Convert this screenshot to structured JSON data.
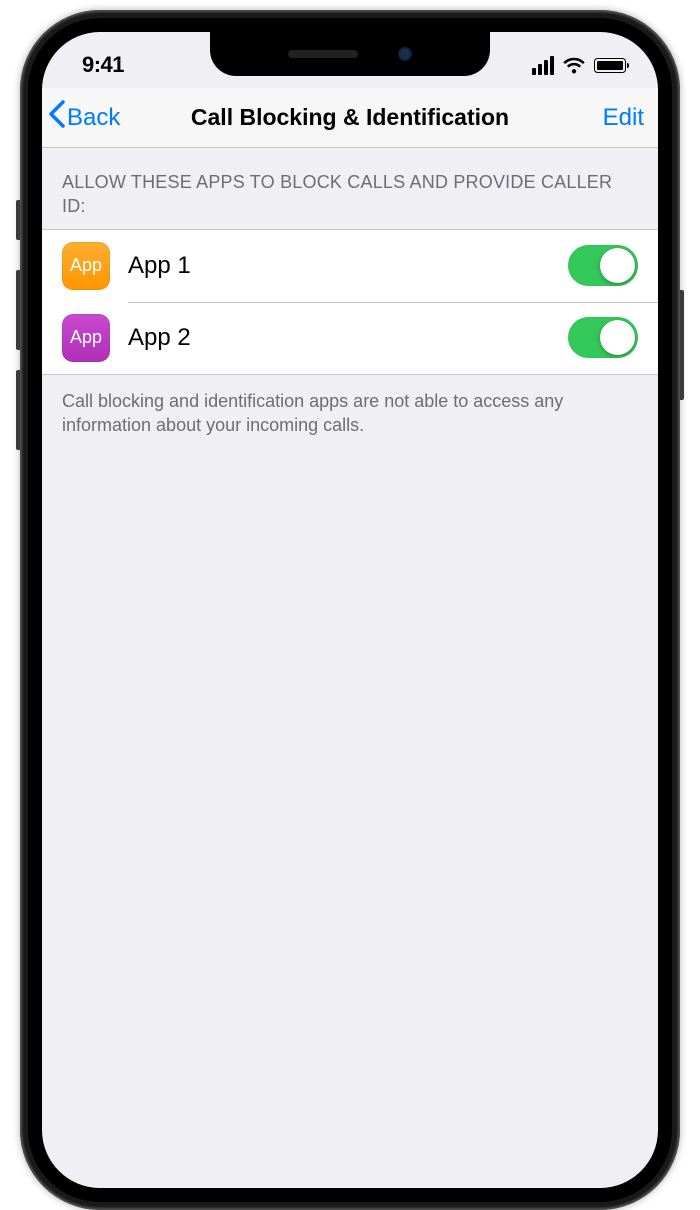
{
  "statusBar": {
    "time": "9:41"
  },
  "nav": {
    "back": "Back",
    "title": "Call Blocking & Identification",
    "edit": "Edit"
  },
  "section": {
    "header": "ALLOW THESE APPS TO BLOCK CALLS AND PROVIDE CALLER ID:",
    "footer": "Call blocking and identification apps are not able to access any information about your incoming calls."
  },
  "apps": [
    {
      "iconLabel": "App",
      "iconColor": "orange",
      "name": "App 1",
      "enabled": true
    },
    {
      "iconLabel": "App",
      "iconColor": "purple",
      "name": "App 2",
      "enabled": true
    }
  ]
}
